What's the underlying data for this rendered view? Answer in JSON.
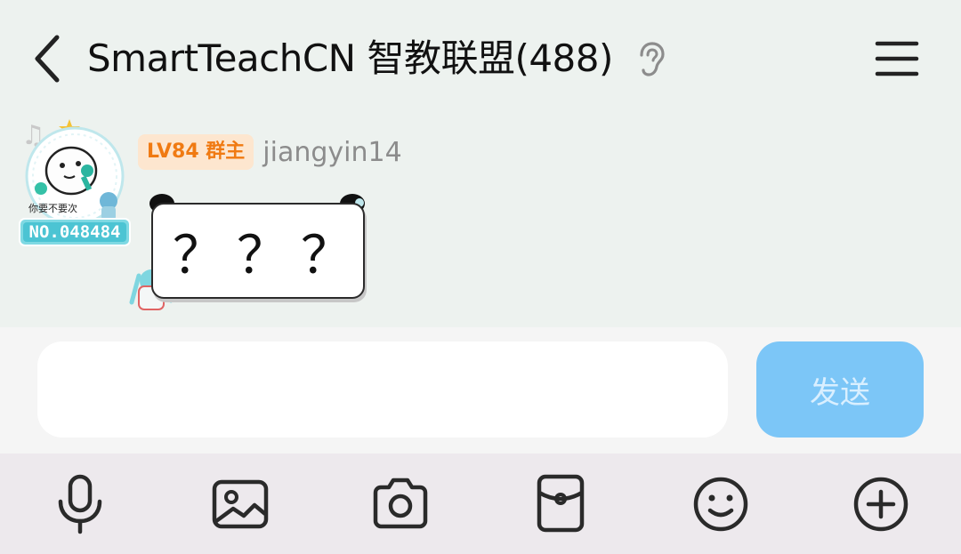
{
  "header": {
    "title": "SmartTeachCN 智教联盟(488)"
  },
  "icons": {
    "back": "chevron-left-icon",
    "listen": "ear-icon",
    "menu": "hamburger-menu-icon"
  },
  "message": {
    "badge": "LV84 群主",
    "sender": "jiangyin14",
    "text": "？？？",
    "avatar_caption": "你要不要次",
    "avatar_number": "NO.048484"
  },
  "composer": {
    "input_value": "",
    "send_label": "发送"
  },
  "toolbar": {
    "items": [
      "microphone-icon",
      "image-icon",
      "camera-icon",
      "red-packet-icon",
      "emoji-icon",
      "plus-icon"
    ]
  },
  "colors": {
    "background": "#edf2ef",
    "badge_bg": "#fde6cf",
    "badge_text": "#f07a12",
    "send_button": "#7cc6f7",
    "toolbar_bg": "#ede9ed"
  }
}
